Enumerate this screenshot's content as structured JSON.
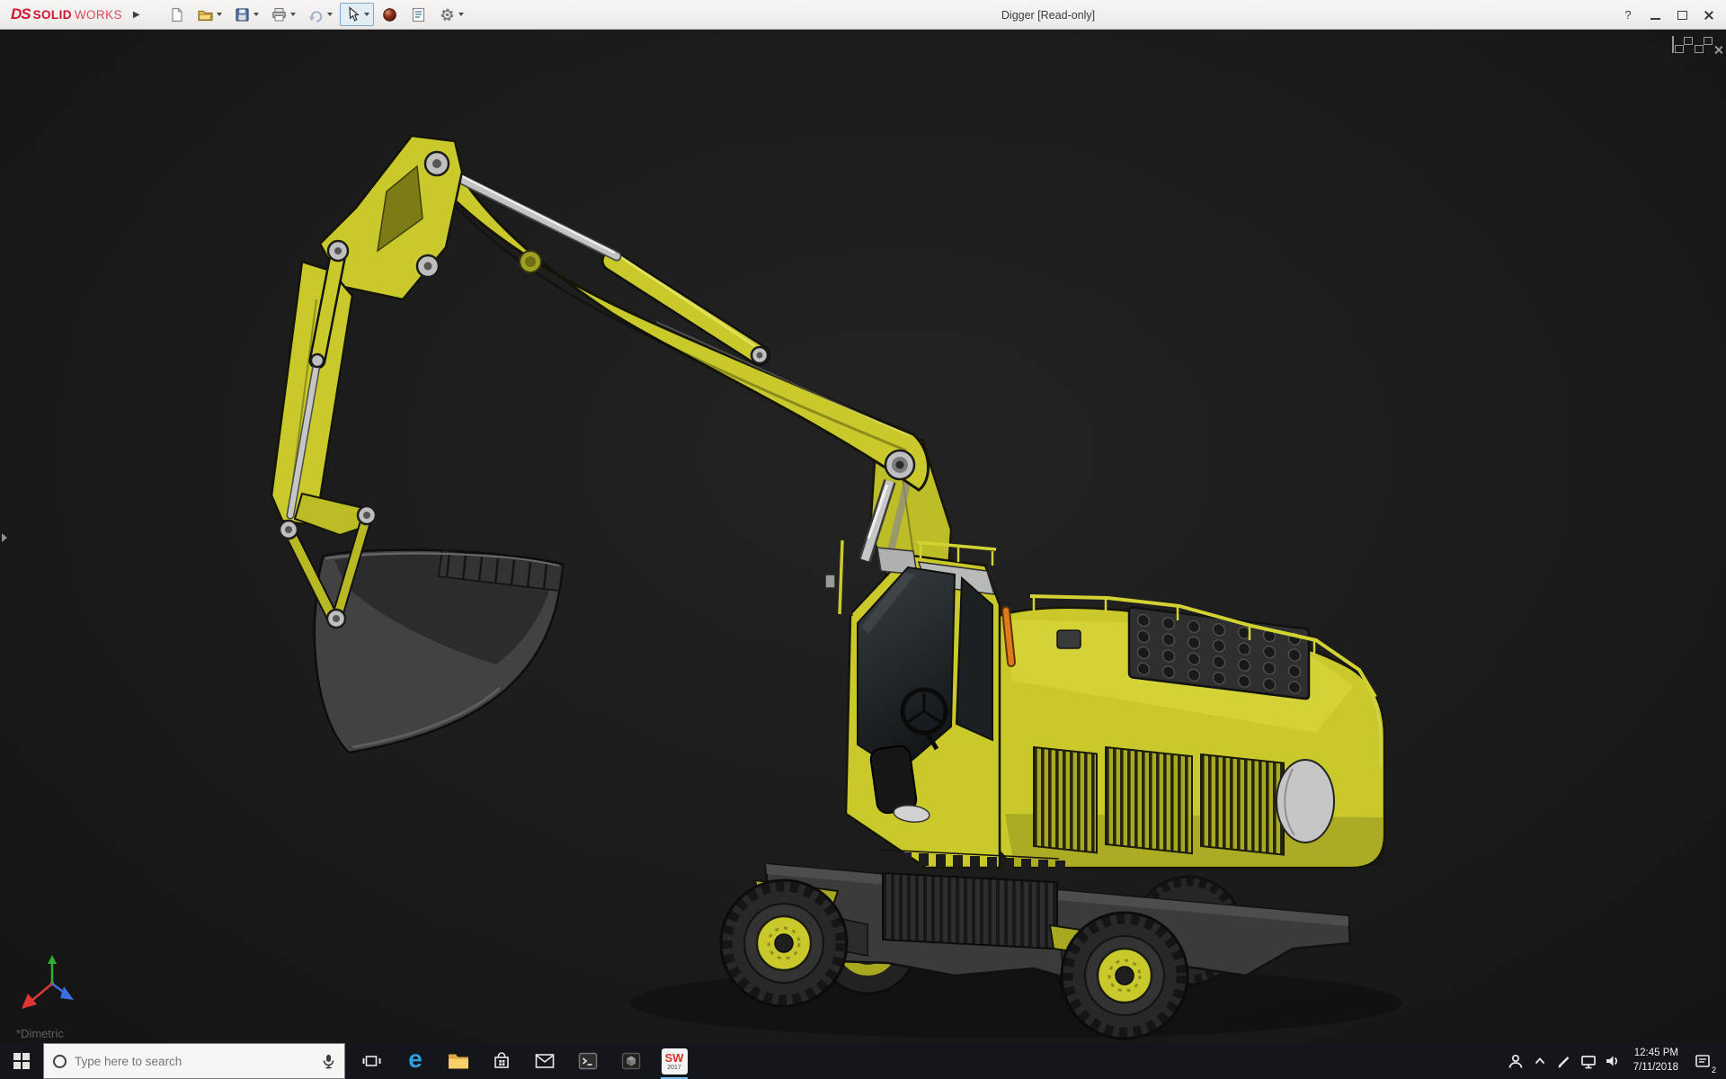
{
  "colors": {
    "sw-red": "#cf1430",
    "titlebar-bg": "#f2f1ef",
    "viewport-bg": "#1b1b1b",
    "taskbar-bg": "#15151c",
    "model-yellow": "#c9c92b",
    "model-yellow-dark": "#9c9c1d",
    "bucket-gray": "#424242",
    "steel-gray": "#c4c4c4",
    "glass-dark": "#24282b",
    "accent-orange": "#e07a1a",
    "edge-blue": "#2aa3e0",
    "active-app-underline": "#76b9ed"
  },
  "titlebar": {
    "logo_glyph": "DS",
    "logo_solid": "SOLID",
    "logo_works": "WORKS",
    "expand_arrow": "▶",
    "document_title": "Digger [Read-only]",
    "help_label": "?",
    "toolbar_buttons": [
      {
        "icon": "new-document-icon",
        "dropdown": false,
        "active": false
      },
      {
        "icon": "open-icon",
        "dropdown": true,
        "active": false
      },
      {
        "icon": "save-icon",
        "dropdown": true,
        "active": false
      },
      {
        "icon": "print-icon",
        "dropdown": true,
        "active": false
      },
      {
        "icon": "undo-icon",
        "dropdown": true,
        "active": false
      },
      {
        "icon": "select-arrow-icon",
        "dropdown": true,
        "active": true
      },
      {
        "icon": "appearance-sphere-icon",
        "dropdown": false,
        "active": false
      },
      {
        "icon": "evaluate-icon",
        "dropdown": false,
        "active": false
      },
      {
        "icon": "options-gear-icon",
        "dropdown": true,
        "active": false
      }
    ],
    "window_controls": [
      "minimize",
      "maximize",
      "close"
    ]
  },
  "viewport": {
    "view_orientation_label": "*Dimetric",
    "window_controls": [
      "new-window",
      "cascade",
      "minimize",
      "restore",
      "close"
    ],
    "triad_axes": [
      "x-red",
      "y-green",
      "z-blue"
    ]
  },
  "taskbar": {
    "search": {
      "placeholder": "Type here to search",
      "icons": [
        "cortana-circle-icon",
        "microphone-icon"
      ]
    },
    "apps": [
      "start",
      "task-view",
      "edge",
      "file-explorer",
      "store",
      "mail",
      "terminal",
      "3d-viewer",
      "solidworks"
    ],
    "edge_glyph": "e",
    "solidworks_badge": "SW",
    "solidworks_year": "2017",
    "tray_icons": [
      "people-icon",
      "hidden-icons-chevron",
      "pen-icon",
      "network-icon",
      "volume-icon"
    ],
    "clock": {
      "time": "12:45 PM",
      "date": "7/11/2018"
    },
    "action_center": {
      "icon": "action-center-icon",
      "badge": "2"
    }
  }
}
